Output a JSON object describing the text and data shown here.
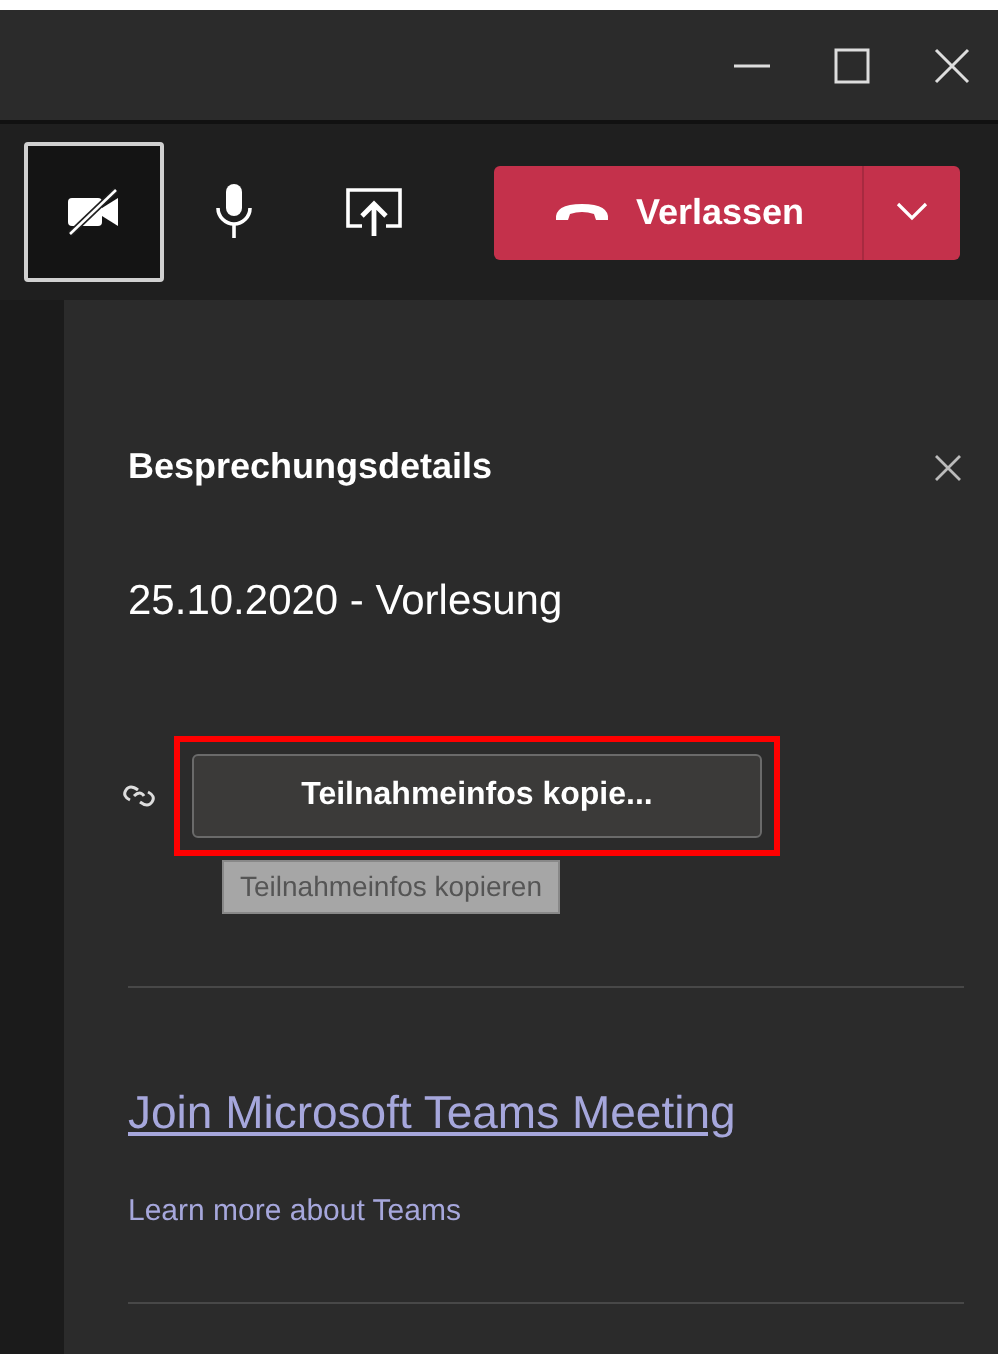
{
  "toolbar": {
    "controls": [
      {
        "kind": "camera-off",
        "selected": true
      },
      {
        "kind": "mic",
        "selected": false
      },
      {
        "kind": "share",
        "selected": false
      }
    ],
    "leave_button": {
      "label": "Verlassen"
    }
  },
  "panel": {
    "title": "Besprechungsdetails",
    "subtitle": "25.10.2020 - Vorlesung",
    "copy_button": {
      "label": "Teilnahmeinfos kopie...",
      "highlighted": true
    },
    "tooltip": "Teilnahmeinfos kopieren",
    "join_link": "Join Microsoft Teams Meeting",
    "learn_link": "Learn more about Teams"
  }
}
